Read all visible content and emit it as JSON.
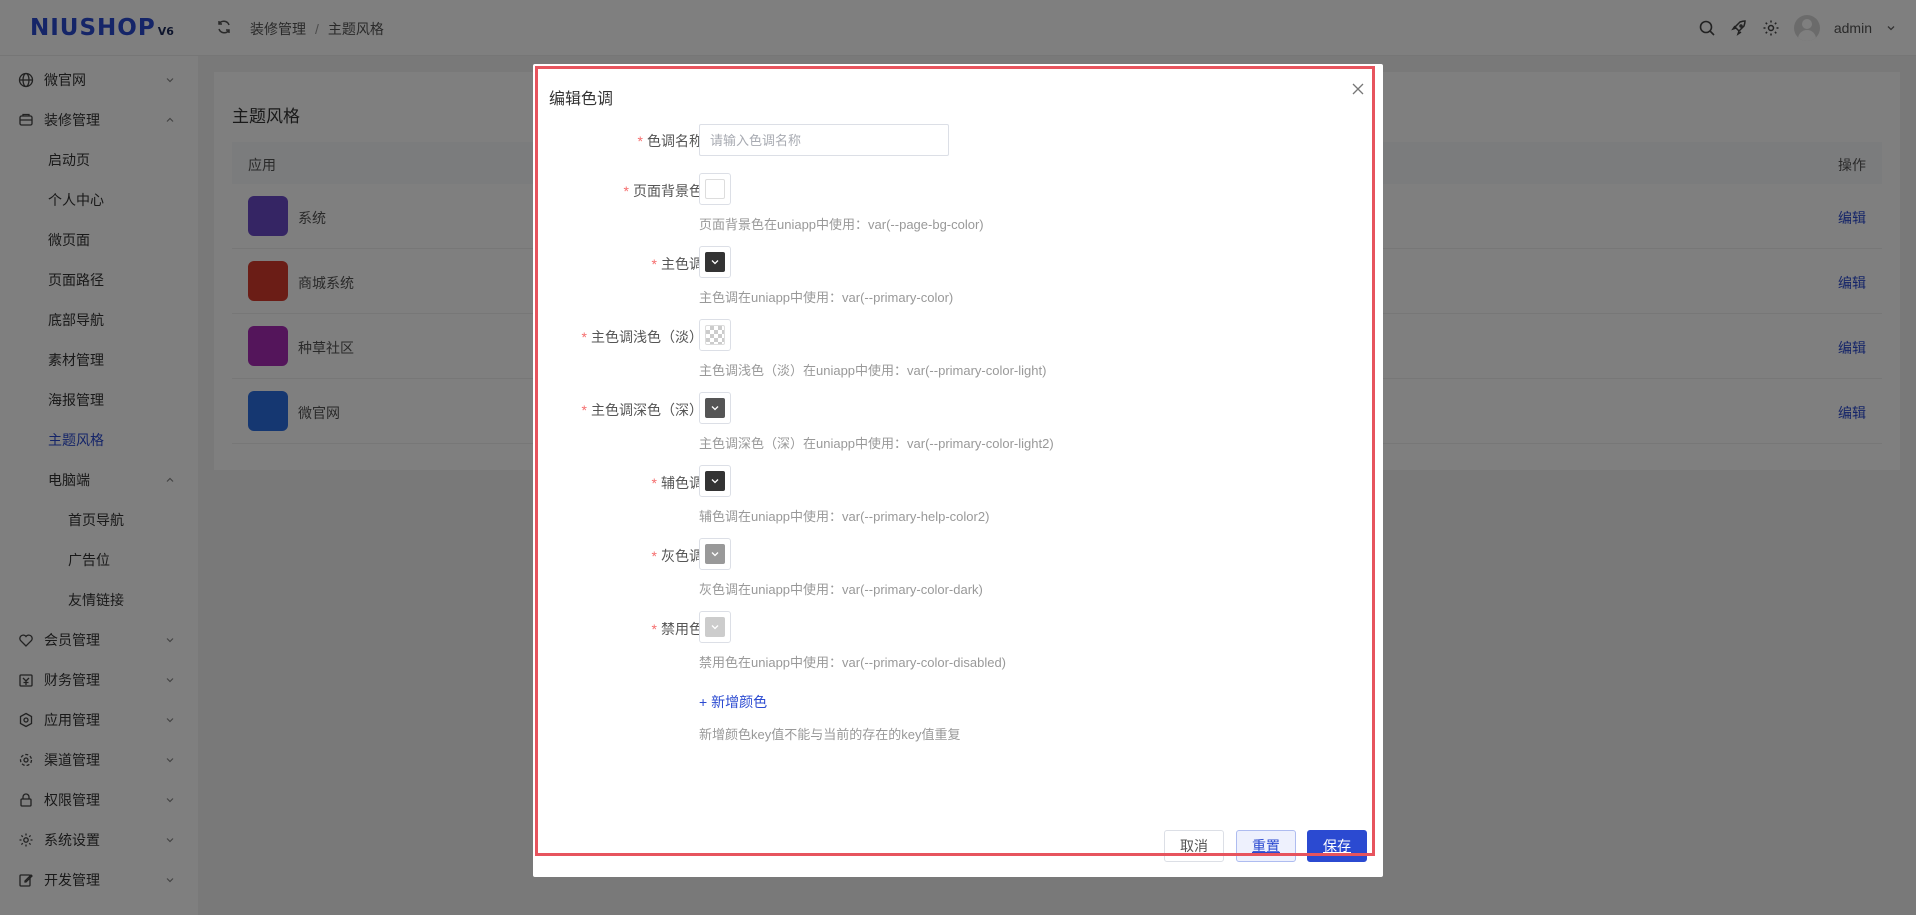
{
  "header": {
    "logo": "NIUSHOP",
    "logo_version": "V6",
    "breadcrumb": [
      "装修管理",
      "主题风格"
    ],
    "user_name": "admin"
  },
  "sidebar": {
    "items": [
      {
        "label": "微官网",
        "icon": "globe-icon",
        "arrow": "chevron-down-icon"
      },
      {
        "label": "装修管理",
        "icon": "decoration-icon",
        "arrow": "chevron-up-icon"
      },
      {
        "label": "启动页"
      },
      {
        "label": "个人中心"
      },
      {
        "label": "微页面"
      },
      {
        "label": "页面路径"
      },
      {
        "label": "底部导航"
      },
      {
        "label": "素材管理"
      },
      {
        "label": "海报管理"
      },
      {
        "label": "主题风格",
        "active": true
      },
      {
        "label": "电脑端",
        "arrow": "chevron-up-icon"
      },
      {
        "label": "首页导航"
      },
      {
        "label": "广告位"
      },
      {
        "label": "友情链接"
      },
      {
        "label": "会员管理",
        "icon": "member-icon",
        "arrow": "chevron-down-icon"
      },
      {
        "label": "财务管理",
        "icon": "finance-icon",
        "arrow": "chevron-down-icon"
      },
      {
        "label": "应用管理",
        "icon": "app-icon",
        "arrow": "chevron-down-icon"
      },
      {
        "label": "渠道管理",
        "icon": "channel-icon",
        "arrow": "chevron-down-icon"
      },
      {
        "label": "权限管理",
        "icon": "lock-icon",
        "arrow": "chevron-down-icon"
      },
      {
        "label": "系统设置",
        "icon": "gear-icon",
        "arrow": "chevron-down-icon"
      },
      {
        "label": "开发管理",
        "icon": "edit-icon",
        "arrow": "chevron-down-icon"
      }
    ]
  },
  "main": {
    "title": "主题风格",
    "table": {
      "col_app": "应用",
      "col_action": "操作",
      "rows": [
        {
          "name": "系统",
          "action": "编辑",
          "color": "#6b4ac8"
        },
        {
          "name": "商城系统",
          "action": "编辑",
          "color": "#d73a2c"
        },
        {
          "name": "种草社区",
          "action": "编辑",
          "color": "#a82ab7"
        },
        {
          "name": "微官网",
          "action": "编辑",
          "color": "#2b6fe3"
        }
      ]
    }
  },
  "dialog": {
    "title": "编辑色调",
    "name_field": {
      "label": "色调名称",
      "placeholder": "请输入色调名称",
      "value": ""
    },
    "colors": [
      {
        "label": "页面背景色",
        "hint": "页面背景色在uniapp中使用：var(--page-bg-color)",
        "value": "#ffffff",
        "style": "empty"
      },
      {
        "label": "主色调",
        "hint": "主色调在uniapp中使用：var(--primary-color)",
        "value": "#333333",
        "style": "solid"
      },
      {
        "label": "主色调浅色（淡）",
        "hint": "主色调浅色（淡）在uniapp中使用：var(--primary-color-light)",
        "value": "",
        "style": "checker"
      },
      {
        "label": "主色调深色（深）",
        "hint": "主色调深色（深）在uniapp中使用：var(--primary-color-light2)",
        "value": "#555555",
        "style": "solid"
      },
      {
        "label": "辅色调",
        "hint": "辅色调在uniapp中使用：var(--primary-help-color2)",
        "value": "#333333",
        "style": "solid"
      },
      {
        "label": "灰色调",
        "hint": "灰色调在uniapp中使用：var(--primary-color-dark)",
        "value": "#999999",
        "style": "solid"
      },
      {
        "label": "禁用色",
        "hint": "禁用色在uniapp中使用：var(--primary-color-disabled)",
        "value": "#cccccc",
        "style": "solid"
      }
    ],
    "add_color": "+ 新增颜色",
    "add_hint": "新增颜色key值不能与当前的存在的key值重复",
    "buttons": {
      "cancel": "取消",
      "reset": "重置",
      "save": "保存"
    }
  },
  "theme": {
    "accent": "#2b4ad1",
    "required": "#f56c6c",
    "highlight_border": "#e7545e"
  }
}
